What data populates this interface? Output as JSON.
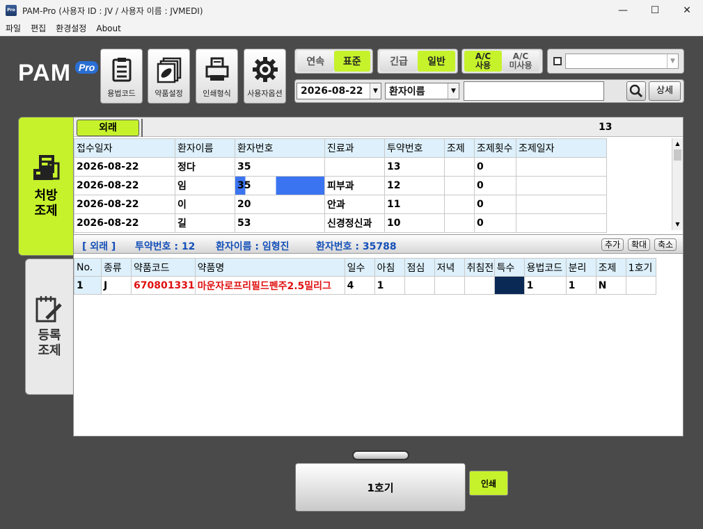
{
  "window": {
    "title": "PAM-Pro (사용자 ID : JV / 사용자 이름 : JVMEDI)",
    "icon_label": "Pro",
    "minimize": "—",
    "maximize": "☐",
    "close": "✕"
  },
  "menu": [
    "파일",
    "편집",
    "환경설정",
    "About"
  ],
  "logo": {
    "text": "PAM",
    "badge": "Pro"
  },
  "toolbar": [
    {
      "label": "용법코드",
      "icon": "clipboard-list-icon"
    },
    {
      "label": "약품설정",
      "icon": "pill-bottle-icon"
    },
    {
      "label": "인쇄형식",
      "icon": "printer-icon"
    },
    {
      "label": "사용자옵션",
      "icon": "gear-icon"
    }
  ],
  "mode_toggle": {
    "continuous": "연속",
    "standard": "표준",
    "selected": "표준"
  },
  "urgency_toggle": {
    "urgent": "긴급",
    "normal": "일반",
    "selected": "일반"
  },
  "ac_toggle": {
    "use_line1": "A/C",
    "use_line2": "사용",
    "nouse_line1": "A/C",
    "nouse_line2": "미사용",
    "selected": "A/C 사용"
  },
  "filter": {
    "date": "2026-08-22",
    "field": "환자이름",
    "query": "",
    "search_icon": "magnifier-icon",
    "detail": "상세"
  },
  "side_tabs": [
    {
      "line1": "처방",
      "line2": "조제",
      "icon": "pharmacy-machine-icon",
      "active": true
    },
    {
      "line1": "등록",
      "line2": "조제",
      "icon": "notepad-pen-icon",
      "active": false
    }
  ],
  "tabs": {
    "active": "외래",
    "count": "13"
  },
  "rx_table": {
    "columns": [
      "접수일자",
      "환자이름",
      "환자번호",
      "진료과",
      "투약번호",
      "조제",
      "조제횟수",
      "조제일자"
    ],
    "rows": [
      [
        "2026-08-22",
        "정다\u0000",
        "35",
        "",
        "13",
        "",
        "0",
        ""
      ],
      [
        "2026-08-22",
        "임",
        "35",
        "피부과",
        "12",
        "",
        "0",
        ""
      ],
      [
        "2026-08-22",
        "이",
        "20",
        "안과",
        "11",
        "",
        "0",
        ""
      ],
      [
        "2026-08-22",
        "길",
        "53",
        "신경정신과",
        "10",
        "",
        "0",
        ""
      ]
    ]
  },
  "selected_info": {
    "section": "[ 외래 ]",
    "dosage_no": "투약번호 : 12",
    "patient_name": "환자이름 : 임형진",
    "patient_no": "환자번호 : 35788",
    "add": "추가",
    "expand": "확대",
    "shrink": "축소"
  },
  "drug_table": {
    "columns": [
      "No.",
      "종류",
      "약품코드",
      "약품명",
      "일수",
      "아침",
      "점심",
      "저녁",
      "취침전",
      "특수",
      "용법코드",
      "분리",
      "조제",
      "1호기"
    ],
    "rows": [
      [
        "1",
        "J",
        "670801331",
        "마운자로프리필드펜주2.5밀리그",
        "4",
        "1",
        "",
        "",
        "",
        "",
        "1",
        "1",
        "N",
        ""
      ]
    ]
  },
  "footer": {
    "machine": "1호기",
    "print": "인쇄"
  },
  "colors": {
    "accent_green": "#c6f22c",
    "info_blue": "#1550b8",
    "drug_red": "#e01010",
    "special_cell": "#0a2a55"
  }
}
